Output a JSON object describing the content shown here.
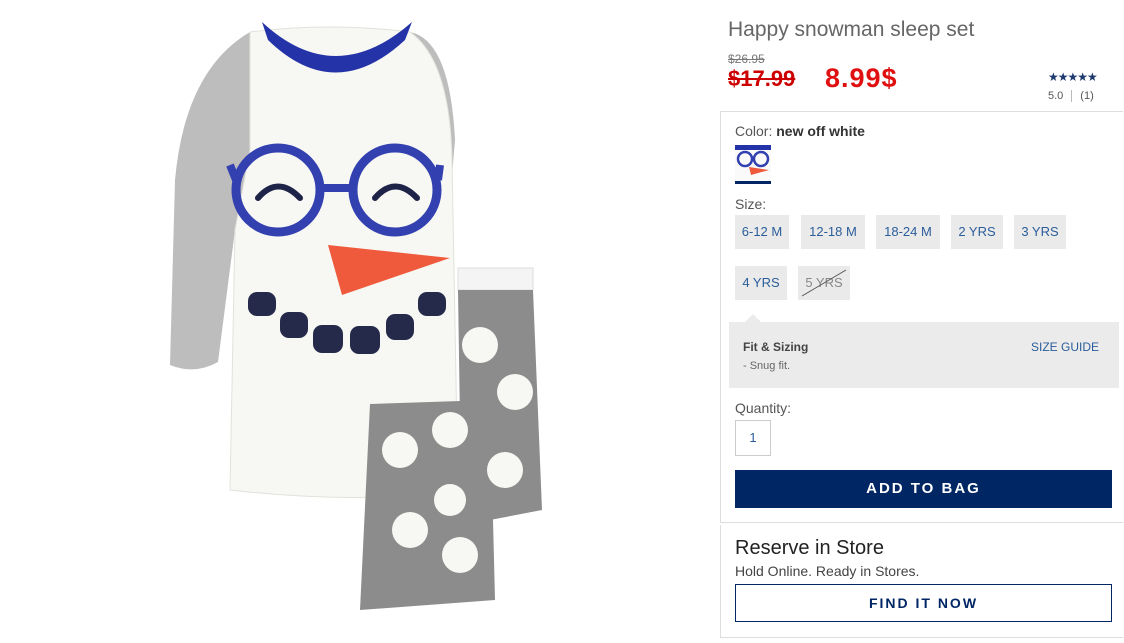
{
  "product": {
    "title": "Happy snowman sleep set",
    "original_price": "$26.95",
    "sale_price": "$17.99",
    "new_price": "8.99$",
    "stars": "★★★★★",
    "rating_value": "5.0",
    "review_count": "(1)"
  },
  "color": {
    "label": "Color:",
    "selected": "new off white"
  },
  "size": {
    "label": "Size:",
    "options": [
      "6-12 M",
      "12-18 M",
      "18-24 M",
      "2 YRS",
      "3 YRS",
      "4 YRS",
      "5 YRS"
    ]
  },
  "fit": {
    "title": "Fit & Sizing",
    "guide_link": "SIZE GUIDE",
    "note": "- Snug fit."
  },
  "quantity": {
    "label": "Quantity:",
    "value": "1"
  },
  "actions": {
    "add_to_bag": "ADD TO BAG"
  },
  "reserve": {
    "title": "Reserve in Store",
    "subtitle": "Hold Online. Ready in Stores.",
    "button": "FIND IT NOW"
  },
  "colors": {
    "navy": "#002664",
    "link_blue": "#2a5d9a",
    "price_red": "#cc0000"
  }
}
